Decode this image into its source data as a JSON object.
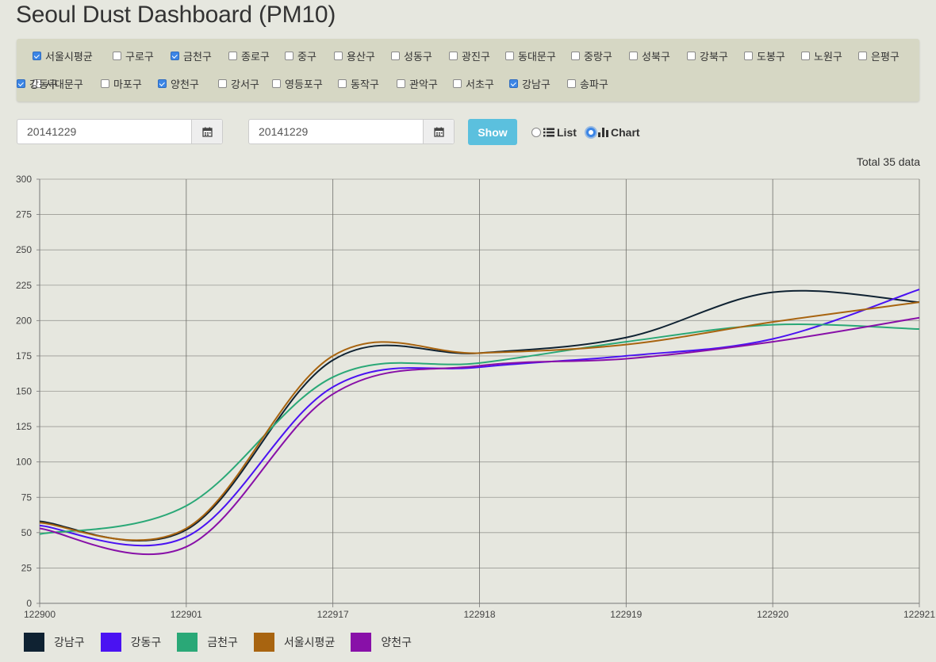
{
  "page": {
    "title": "Seoul Dust Dashboard (PM10)"
  },
  "regions": [
    {
      "name": "서울시평균",
      "checked": true
    },
    {
      "name": "구로구",
      "checked": false
    },
    {
      "name": "금천구",
      "checked": true
    },
    {
      "name": "종로구",
      "checked": false
    },
    {
      "name": "중구",
      "checked": false
    },
    {
      "name": "용산구",
      "checked": false
    },
    {
      "name": "성동구",
      "checked": false
    },
    {
      "name": "광진구",
      "checked": false
    },
    {
      "name": "동대문구",
      "checked": false
    },
    {
      "name": "중랑구",
      "checked": false
    },
    {
      "name": "성북구",
      "checked": false
    },
    {
      "name": "강북구",
      "checked": false
    },
    {
      "name": "도봉구",
      "checked": false
    },
    {
      "name": "노원구",
      "checked": false
    },
    {
      "name": "은평구",
      "checked": false
    },
    {
      "name": "서대문구",
      "checked": false
    },
    {
      "name": "마포구",
      "checked": false
    },
    {
      "name": "양천구",
      "checked": true
    },
    {
      "name": "강서구",
      "checked": false
    },
    {
      "name": "영등포구",
      "checked": false
    },
    {
      "name": "동작구",
      "checked": false
    },
    {
      "name": "관악구",
      "checked": false
    },
    {
      "name": "서초구",
      "checked": false
    },
    {
      "name": "강남구",
      "checked": true
    },
    {
      "name": "송파구",
      "checked": false
    },
    {
      "name": "강동구",
      "checked": true
    }
  ],
  "controls": {
    "start_date": "20141229",
    "end_date": "20141229",
    "show_label": "Show",
    "list_label": "List",
    "chart_label": "Chart",
    "view_mode": "Chart",
    "calendar_icon": "calendar-icon",
    "list_icon": "list-icon",
    "chart_icon": "bar-chart-icon"
  },
  "total_text": "Total 35 data",
  "chart_data": {
    "type": "line",
    "x": [
      "122900",
      "122901",
      "122917",
      "122918",
      "122919",
      "122920",
      "122921"
    ],
    "ylim": [
      0,
      300
    ],
    "yticks": [
      0,
      25,
      50,
      75,
      100,
      125,
      150,
      175,
      200,
      225,
      250,
      275,
      300
    ],
    "grid": true,
    "legend_position": "bottom-left",
    "series": [
      {
        "name": "강남구",
        "color": "#0f2232",
        "values": [
          58,
          52,
          172,
          177,
          188,
          220,
          213
        ]
      },
      {
        "name": "강동구",
        "color": "#4a12f2",
        "values": [
          55,
          47,
          153,
          167,
          175,
          187,
          222
        ]
      },
      {
        "name": "금천구",
        "color": "#2aa877",
        "values": [
          49,
          69,
          160,
          170,
          185,
          197,
          194
        ]
      },
      {
        "name": "서울시평균",
        "color": "#a86410",
        "values": [
          57,
          53,
          175,
          177,
          183,
          199,
          213
        ]
      },
      {
        "name": "양천구",
        "color": "#8810a8",
        "values": [
          53,
          40,
          148,
          168,
          173,
          185,
          202
        ]
      }
    ]
  }
}
